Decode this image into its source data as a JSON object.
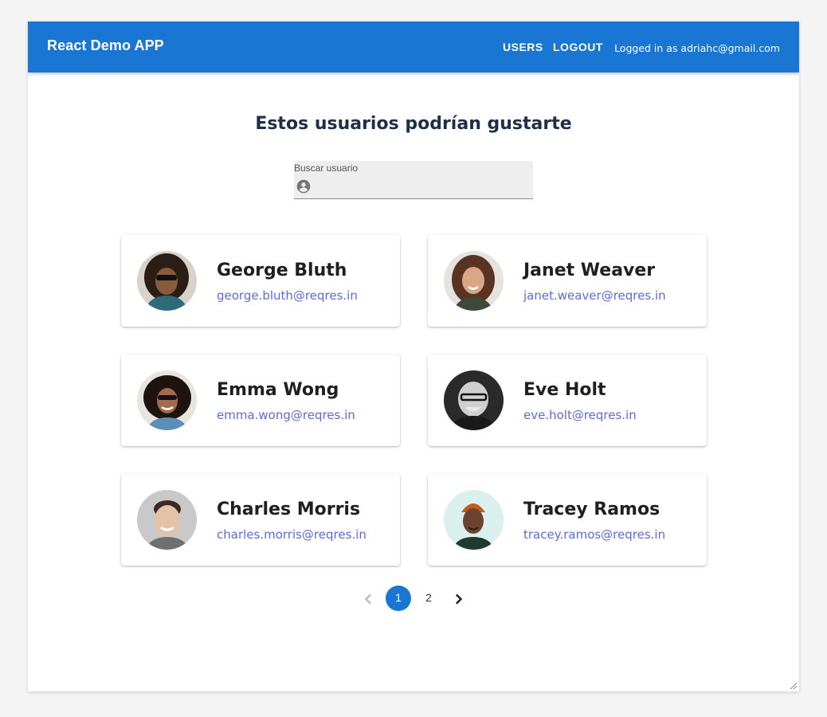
{
  "header": {
    "brand": "React Demo APP",
    "nav": [
      {
        "label": "USERS"
      },
      {
        "label": "LOGOUT"
      }
    ],
    "logged_in_text": "Logged in as adriahc@gmail.com"
  },
  "main": {
    "title": "Estos usuarios podrían gustarte",
    "search": {
      "label": "Buscar usuario",
      "value": "",
      "icon": "account-circle-icon"
    },
    "users": [
      {
        "name": "George Bluth",
        "email": "george.bluth@reqres.in"
      },
      {
        "name": "Janet Weaver",
        "email": "janet.weaver@reqres.in"
      },
      {
        "name": "Emma Wong",
        "email": "emma.wong@reqres.in"
      },
      {
        "name": "Eve Holt",
        "email": "eve.holt@reqres.in"
      },
      {
        "name": "Charles Morris",
        "email": "charles.morris@reqres.in"
      },
      {
        "name": "Tracey Ramos",
        "email": "tracey.ramos@reqres.in"
      }
    ],
    "pagination": {
      "pages": [
        "1",
        "2"
      ],
      "current": "1"
    }
  },
  "colors": {
    "appbar": "#1976d2",
    "heading": "#1e3048",
    "email_link": "#5c6bd8",
    "active_page": "#1976d2"
  }
}
